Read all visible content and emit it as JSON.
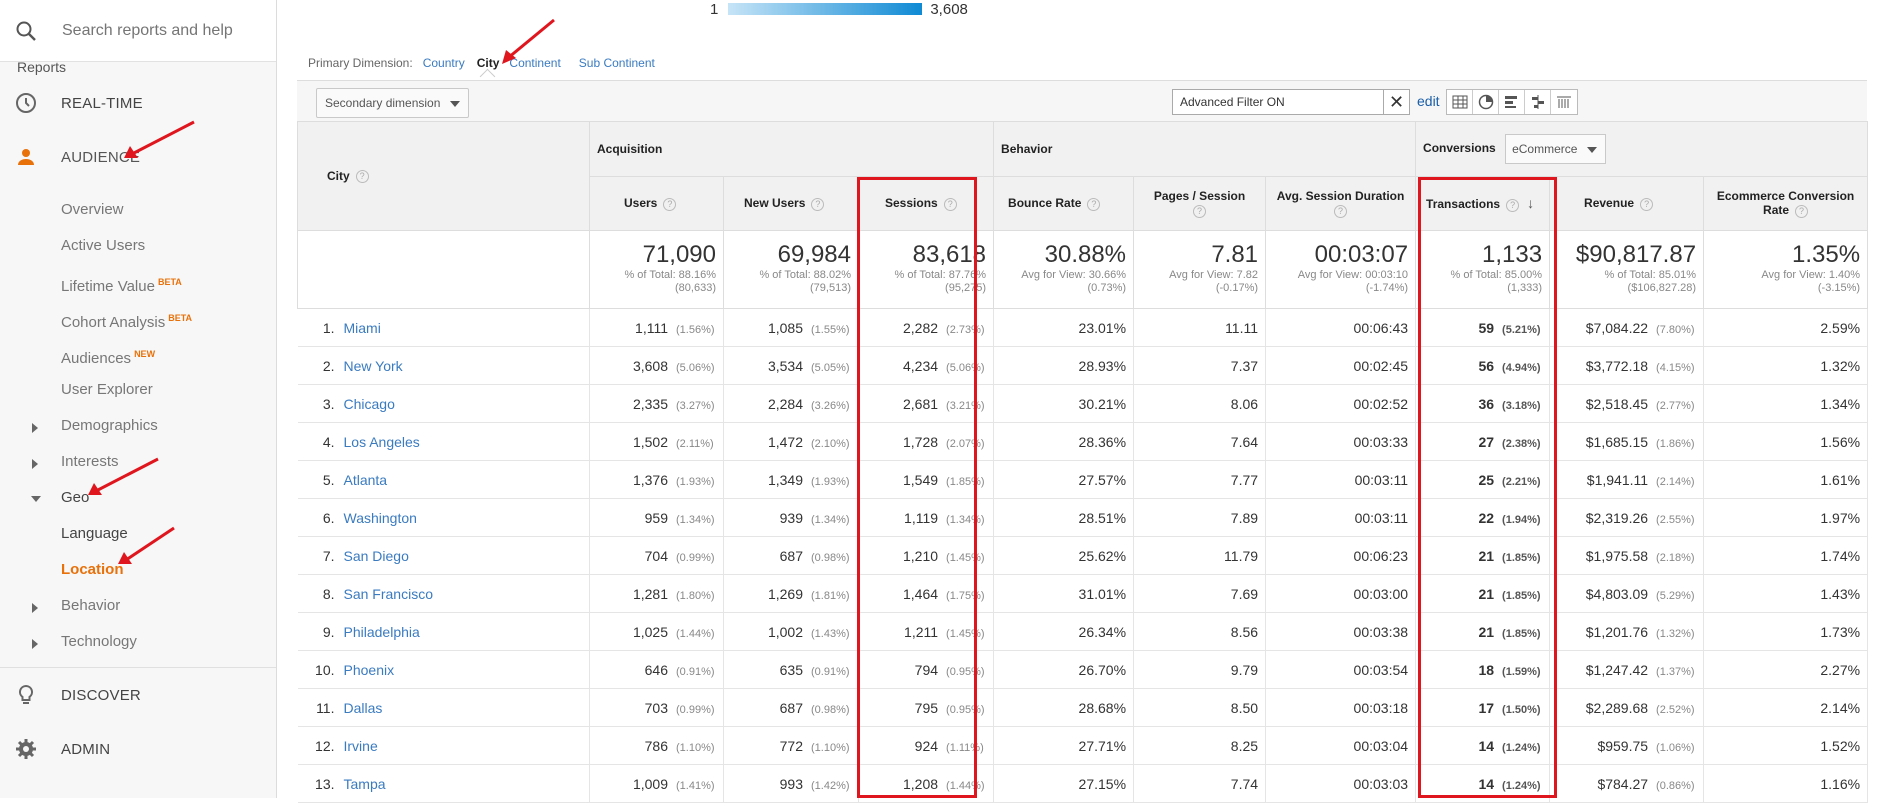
{
  "sidebar": {
    "search_placeholder": "Search reports and help",
    "reports_label": "Reports",
    "realtime": "REAL-TIME",
    "audience": "AUDIENCE",
    "items": [
      {
        "label": "Overview",
        "badge": ""
      },
      {
        "label": "Active Users",
        "badge": ""
      },
      {
        "label": "Lifetime Value",
        "badge": "BETA"
      },
      {
        "label": "Cohort Analysis",
        "badge": "BETA"
      },
      {
        "label": "Audiences",
        "badge": "NEW"
      },
      {
        "label": "User Explorer",
        "badge": ""
      },
      {
        "label": "Demographics",
        "badge": ""
      },
      {
        "label": "Interests",
        "badge": ""
      },
      {
        "label": "Geo",
        "badge": ""
      },
      {
        "label": "Language",
        "badge": ""
      },
      {
        "label": "Location",
        "badge": ""
      },
      {
        "label": "Behavior",
        "badge": ""
      },
      {
        "label": "Technology",
        "badge": ""
      }
    ],
    "discover": "DISCOVER",
    "admin": "ADMIN"
  },
  "legend": {
    "min": "1",
    "max": "3,608"
  },
  "primary_dimension": {
    "label": "Primary Dimension:",
    "options": [
      "Country",
      "City",
      "Continent",
      "Sub Continent"
    ],
    "selected": "City"
  },
  "toolbar": {
    "secondary_dimension": "Secondary dimension",
    "filter_value": "Advanced Filter ON",
    "edit": "edit"
  },
  "table": {
    "groups": {
      "acquisition": "Acquisition",
      "behavior": "Behavior",
      "conversions": "Conversions",
      "conversion_select": "eCommerce"
    },
    "headers": {
      "city": "City",
      "users": "Users",
      "new_users": "New Users",
      "sessions": "Sessions",
      "bounce_rate": "Bounce Rate",
      "pages_session": "Pages / Session",
      "avg_duration": "Avg. Session Duration",
      "transactions": "Transactions",
      "revenue": "Revenue",
      "ecr": "Ecommerce Conversion Rate"
    },
    "totals": {
      "users": {
        "big": "71,090",
        "l1": "% of Total: 88.16%",
        "l2": "(80,633)"
      },
      "new_users": {
        "big": "69,984",
        "l1": "% of Total: 88.02%",
        "l2": "(79,513)"
      },
      "sessions": {
        "big": "83,618",
        "l1": "% of Total: 87.76%",
        "l2": "(95,275)"
      },
      "bounce_rate": {
        "big": "30.88%",
        "l1": "Avg for View: 30.66%",
        "l2": "(0.73%)"
      },
      "pages_session": {
        "big": "7.81",
        "l1": "Avg for View: 7.82",
        "l2": "(-0.17%)"
      },
      "avg_duration": {
        "big": "00:03:07",
        "l1": "Avg for View: 00:03:10",
        "l2": "(-1.74%)"
      },
      "transactions": {
        "big": "1,133",
        "l1": "% of Total: 85.00%",
        "l2": "(1,333)"
      },
      "revenue": {
        "big": "$90,817.87",
        "l1": "% of Total: 85.01%",
        "l2": "($106,827.28)"
      },
      "ecr": {
        "big": "1.35%",
        "l1": "Avg for View: 1.40%",
        "l2": "(-3.15%)"
      }
    },
    "rows": [
      {
        "idx": "1.",
        "city": "Miami",
        "users": "1,111",
        "users_p": "(1.56%)",
        "new_users": "1,085",
        "new_users_p": "(1.55%)",
        "sessions": "2,282",
        "sessions_p": "(2.73%)",
        "bounce": "23.01%",
        "pages": "11.11",
        "dur": "00:06:43",
        "tx": "59",
        "tx_p": "(5.21%)",
        "rev": "$7,084.22",
        "rev_p": "(7.80%)",
        "ecr": "2.59%"
      },
      {
        "idx": "2.",
        "city": "New York",
        "users": "3,608",
        "users_p": "(5.06%)",
        "new_users": "3,534",
        "new_users_p": "(5.05%)",
        "sessions": "4,234",
        "sessions_p": "(5.06%)",
        "bounce": "28.93%",
        "pages": "7.37",
        "dur": "00:02:45",
        "tx": "56",
        "tx_p": "(4.94%)",
        "rev": "$3,772.18",
        "rev_p": "(4.15%)",
        "ecr": "1.32%"
      },
      {
        "idx": "3.",
        "city": "Chicago",
        "users": "2,335",
        "users_p": "(3.27%)",
        "new_users": "2,284",
        "new_users_p": "(3.26%)",
        "sessions": "2,681",
        "sessions_p": "(3.21%)",
        "bounce": "30.21%",
        "pages": "8.06",
        "dur": "00:02:52",
        "tx": "36",
        "tx_p": "(3.18%)",
        "rev": "$2,518.45",
        "rev_p": "(2.77%)",
        "ecr": "1.34%"
      },
      {
        "idx": "4.",
        "city": "Los Angeles",
        "users": "1,502",
        "users_p": "(2.11%)",
        "new_users": "1,472",
        "new_users_p": "(2.10%)",
        "sessions": "1,728",
        "sessions_p": "(2.07%)",
        "bounce": "28.36%",
        "pages": "7.64",
        "dur": "00:03:33",
        "tx": "27",
        "tx_p": "(2.38%)",
        "rev": "$1,685.15",
        "rev_p": "(1.86%)",
        "ecr": "1.56%"
      },
      {
        "idx": "5.",
        "city": "Atlanta",
        "users": "1,376",
        "users_p": "(1.93%)",
        "new_users": "1,349",
        "new_users_p": "(1.93%)",
        "sessions": "1,549",
        "sessions_p": "(1.85%)",
        "bounce": "27.57%",
        "pages": "7.77",
        "dur": "00:03:11",
        "tx": "25",
        "tx_p": "(2.21%)",
        "rev": "$1,941.11",
        "rev_p": "(2.14%)",
        "ecr": "1.61%"
      },
      {
        "idx": "6.",
        "city": "Washington",
        "users": "959",
        "users_p": "(1.34%)",
        "new_users": "939",
        "new_users_p": "(1.34%)",
        "sessions": "1,119",
        "sessions_p": "(1.34%)",
        "bounce": "28.51%",
        "pages": "7.89",
        "dur": "00:03:11",
        "tx": "22",
        "tx_p": "(1.94%)",
        "rev": "$2,319.26",
        "rev_p": "(2.55%)",
        "ecr": "1.97%"
      },
      {
        "idx": "7.",
        "city": "San Diego",
        "users": "704",
        "users_p": "(0.99%)",
        "new_users": "687",
        "new_users_p": "(0.98%)",
        "sessions": "1,210",
        "sessions_p": "(1.45%)",
        "bounce": "25.62%",
        "pages": "11.79",
        "dur": "00:06:23",
        "tx": "21",
        "tx_p": "(1.85%)",
        "rev": "$1,975.58",
        "rev_p": "(2.18%)",
        "ecr": "1.74%"
      },
      {
        "idx": "8.",
        "city": "San Francisco",
        "users": "1,281",
        "users_p": "(1.80%)",
        "new_users": "1,269",
        "new_users_p": "(1.81%)",
        "sessions": "1,464",
        "sessions_p": "(1.75%)",
        "bounce": "31.01%",
        "pages": "7.69",
        "dur": "00:03:00",
        "tx": "21",
        "tx_p": "(1.85%)",
        "rev": "$4,803.09",
        "rev_p": "(5.29%)",
        "ecr": "1.43%"
      },
      {
        "idx": "9.",
        "city": "Philadelphia",
        "users": "1,025",
        "users_p": "(1.44%)",
        "new_users": "1,002",
        "new_users_p": "(1.43%)",
        "sessions": "1,211",
        "sessions_p": "(1.45%)",
        "bounce": "26.34%",
        "pages": "8.56",
        "dur": "00:03:38",
        "tx": "21",
        "tx_p": "(1.85%)",
        "rev": "$1,201.76",
        "rev_p": "(1.32%)",
        "ecr": "1.73%"
      },
      {
        "idx": "10.",
        "city": "Phoenix",
        "users": "646",
        "users_p": "(0.91%)",
        "new_users": "635",
        "new_users_p": "(0.91%)",
        "sessions": "794",
        "sessions_p": "(0.95%)",
        "bounce": "26.70%",
        "pages": "9.79",
        "dur": "00:03:54",
        "tx": "18",
        "tx_p": "(1.59%)",
        "rev": "$1,247.42",
        "rev_p": "(1.37%)",
        "ecr": "2.27%"
      },
      {
        "idx": "11.",
        "city": "Dallas",
        "users": "703",
        "users_p": "(0.99%)",
        "new_users": "687",
        "new_users_p": "(0.98%)",
        "sessions": "795",
        "sessions_p": "(0.95%)",
        "bounce": "28.68%",
        "pages": "8.50",
        "dur": "00:03:18",
        "tx": "17",
        "tx_p": "(1.50%)",
        "rev": "$2,289.68",
        "rev_p": "(2.52%)",
        "ecr": "2.14%"
      },
      {
        "idx": "12.",
        "city": "Irvine",
        "users": "786",
        "users_p": "(1.10%)",
        "new_users": "772",
        "new_users_p": "(1.10%)",
        "sessions": "924",
        "sessions_p": "(1.11%)",
        "bounce": "27.71%",
        "pages": "8.25",
        "dur": "00:03:04",
        "tx": "14",
        "tx_p": "(1.24%)",
        "rev": "$959.75",
        "rev_p": "(1.06%)",
        "ecr": "1.52%"
      },
      {
        "idx": "13.",
        "city": "Tampa",
        "users": "1,009",
        "users_p": "(1.41%)",
        "new_users": "993",
        "new_users_p": "(1.42%)",
        "sessions": "1,208",
        "sessions_p": "(1.44%)",
        "bounce": "27.15%",
        "pages": "7.74",
        "dur": "00:03:03",
        "tx": "14",
        "tx_p": "(1.24%)",
        "rev": "$784.27",
        "rev_p": "(0.86%)",
        "ecr": "1.16%"
      }
    ]
  },
  "colors": {
    "accent_orange": "#e8710a",
    "link_blue": "#3a7bc0",
    "highlight_red": "#e0161e"
  }
}
